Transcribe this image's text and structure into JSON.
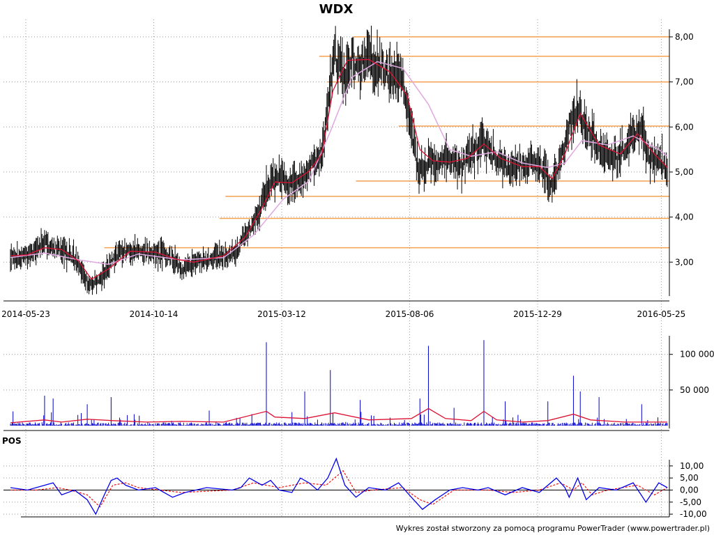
{
  "chart_data": {
    "type": "line",
    "title": "WDX",
    "subtitle": "",
    "xlabel": "",
    "ylabel": "",
    "footer": "Wykres został stworzony za pomocą programu PowerTrader (www.powertrader.pl)",
    "x_tick_labels": [
      "2014-05-23",
      "2014-10-14",
      "2015-03-12",
      "2015-08-06",
      "2015-12-29",
      "2016-05-25"
    ],
    "grid": true,
    "colors": {
      "price": "#000000",
      "ma_short": "#dd1133",
      "ma_long": "#e0a8e0",
      "levels": "#f5a050",
      "volume": "#0000cc",
      "volume_ma": "#dd1133",
      "pos": "#0000ee",
      "pos_signal": "#ee1111"
    },
    "price_panel": {
      "ylim": [
        2.2,
        8.2
      ],
      "y_ticks": [
        3,
        4,
        5,
        6,
        7,
        8
      ],
      "y_tick_labels": [
        "3,00",
        "4,00",
        "5,00",
        "6,00",
        "7,00",
        "8,00"
      ],
      "close_series": [
        [
          0,
          3.12
        ],
        [
          10,
          3.1
        ],
        [
          20,
          3.18
        ],
        [
          30,
          3.25
        ],
        [
          40,
          3.45
        ],
        [
          50,
          3.3
        ],
        [
          60,
          3.25
        ],
        [
          70,
          3.15
        ],
        [
          80,
          3.0
        ],
        [
          88,
          2.6
        ],
        [
          95,
          2.5
        ],
        [
          105,
          2.65
        ],
        [
          115,
          2.9
        ],
        [
          125,
          3.2
        ],
        [
          135,
          3.25
        ],
        [
          150,
          3.25
        ],
        [
          165,
          3.2
        ],
        [
          180,
          3.18
        ],
        [
          190,
          3.1
        ],
        [
          200,
          2.85
        ],
        [
          210,
          2.95
        ],
        [
          220,
          3.0
        ],
        [
          240,
          3.1
        ],
        [
          255,
          3.15
        ],
        [
          265,
          3.2
        ],
        [
          275,
          3.6
        ],
        [
          285,
          3.85
        ],
        [
          295,
          4.3
        ],
        [
          305,
          4.85
        ],
        [
          315,
          4.9
        ],
        [
          325,
          4.75
        ],
        [
          335,
          4.7
        ],
        [
          345,
          4.9
        ],
        [
          355,
          5.2
        ],
        [
          365,
          5.4
        ],
        [
          372,
          6.5
        ],
        [
          380,
          7.6
        ],
        [
          390,
          7.2
        ],
        [
          400,
          7.5
        ],
        [
          410,
          7.3
        ],
        [
          420,
          7.6
        ],
        [
          430,
          7.3
        ],
        [
          445,
          7.2
        ],
        [
          460,
          7.0
        ],
        [
          470,
          6.0
        ],
        [
          478,
          5.0
        ],
        [
          490,
          5.3
        ],
        [
          500,
          5.2
        ],
        [
          510,
          5.3
        ],
        [
          520,
          5.2
        ],
        [
          530,
          5.15
        ],
        [
          545,
          5.5
        ],
        [
          555,
          5.7
        ],
        [
          565,
          5.4
        ],
        [
          575,
          5.2
        ],
        [
          590,
          5.1
        ],
        [
          610,
          5.2
        ],
        [
          625,
          5.1
        ],
        [
          635,
          4.7
        ],
        [
          645,
          5.3
        ],
        [
          655,
          6.0
        ],
        [
          665,
          6.4
        ],
        [
          672,
          6.0
        ],
        [
          680,
          5.8
        ],
        [
          690,
          5.5
        ],
        [
          700,
          5.4
        ],
        [
          710,
          5.3
        ],
        [
          720,
          5.5
        ],
        [
          730,
          5.9
        ],
        [
          740,
          5.9
        ],
        [
          750,
          5.2
        ],
        [
          760,
          5.3
        ],
        [
          770,
          5.05
        ]
      ],
      "ma_short_series": [
        [
          0,
          3.14
        ],
        [
          20,
          3.16
        ],
        [
          40,
          3.32
        ],
        [
          60,
          3.28
        ],
        [
          80,
          3.02
        ],
        [
          95,
          2.62
        ],
        [
          115,
          2.85
        ],
        [
          140,
          3.24
        ],
        [
          170,
          3.22
        ],
        [
          195,
          3.06
        ],
        [
          215,
          3.0
        ],
        [
          250,
          3.14
        ],
        [
          275,
          3.55
        ],
        [
          295,
          4.2
        ],
        [
          310,
          4.78
        ],
        [
          330,
          4.76
        ],
        [
          350,
          5.02
        ],
        [
          365,
          5.4
        ],
        [
          378,
          6.8
        ],
        [
          395,
          7.48
        ],
        [
          420,
          7.5
        ],
        [
          445,
          7.22
        ],
        [
          465,
          6.7
        ],
        [
          480,
          5.5
        ],
        [
          495,
          5.25
        ],
        [
          515,
          5.22
        ],
        [
          535,
          5.3
        ],
        [
          555,
          5.62
        ],
        [
          575,
          5.3
        ],
        [
          600,
          5.12
        ],
        [
          620,
          5.12
        ],
        [
          635,
          4.85
        ],
        [
          650,
          5.4
        ],
        [
          668,
          6.3
        ],
        [
          690,
          5.6
        ],
        [
          715,
          5.4
        ],
        [
          735,
          5.85
        ],
        [
          755,
          5.4
        ],
        [
          770,
          5.1
        ]
      ],
      "ma_long_series": [
        [
          0,
          3.1
        ],
        [
          40,
          3.2
        ],
        [
          80,
          3.05
        ],
        [
          115,
          2.95
        ],
        [
          150,
          3.18
        ],
        [
          200,
          3.05
        ],
        [
          250,
          3.1
        ],
        [
          285,
          3.6
        ],
        [
          320,
          4.4
        ],
        [
          350,
          4.8
        ],
        [
          375,
          5.9
        ],
        [
          400,
          7.1
        ],
        [
          430,
          7.45
        ],
        [
          460,
          7.3
        ],
        [
          490,
          6.5
        ],
        [
          515,
          5.5
        ],
        [
          540,
          5.35
        ],
        [
          570,
          5.45
        ],
        [
          600,
          5.2
        ],
        [
          630,
          5.1
        ],
        [
          650,
          5.2
        ],
        [
          670,
          5.7
        ],
        [
          700,
          5.6
        ],
        [
          730,
          5.8
        ],
        [
          760,
          5.5
        ],
        [
          770,
          5.35
        ]
      ],
      "horizontal_levels": [
        {
          "y": 8.0,
          "x_start": 402
        },
        {
          "y": 7.57,
          "x_start": 362
        },
        {
          "y": 7.0,
          "x_start": 372
        },
        {
          "y": 6.02,
          "x_start": 455
        },
        {
          "y": 4.8,
          "x_start": 405
        },
        {
          "y": 4.46,
          "x_start": 252
        },
        {
          "y": 3.97,
          "x_start": 245
        },
        {
          "y": 3.32,
          "x_start": 110
        }
      ]
    },
    "volume_panel": {
      "ylim": [
        0,
        130000
      ],
      "y_ticks": [
        50000,
        100000
      ],
      "y_tick_labels": [
        "50 000",
        "100 000"
      ],
      "spikes": [
        [
          40,
          42000
        ],
        [
          50,
          38000
        ],
        [
          90,
          30000
        ],
        [
          118,
          40000
        ],
        [
          300,
          117000
        ],
        [
          345,
          48000
        ],
        [
          375,
          78000
        ],
        [
          410,
          36000
        ],
        [
          480,
          38000
        ],
        [
          490,
          112000
        ],
        [
          520,
          25000
        ],
        [
          580,
          34000
        ],
        [
          555,
          120000
        ],
        [
          630,
          34000
        ],
        [
          660,
          70000
        ],
        [
          668,
          48000
        ],
        [
          690,
          40000
        ],
        [
          740,
          30000
        ]
      ],
      "ma_series": [
        [
          0,
          4000
        ],
        [
          40,
          8000
        ],
        [
          60,
          5000
        ],
        [
          90,
          9000
        ],
        [
          120,
          7000
        ],
        [
          160,
          5000
        ],
        [
          200,
          6000
        ],
        [
          250,
          5000
        ],
        [
          300,
          20000
        ],
        [
          310,
          12000
        ],
        [
          345,
          10000
        ],
        [
          380,
          18000
        ],
        [
          420,
          8000
        ],
        [
          470,
          10000
        ],
        [
          490,
          24000
        ],
        [
          510,
          10000
        ],
        [
          540,
          7000
        ],
        [
          555,
          20000
        ],
        [
          570,
          8000
        ],
        [
          600,
          5000
        ],
        [
          630,
          7000
        ],
        [
          660,
          16000
        ],
        [
          680,
          8000
        ],
        [
          720,
          5000
        ],
        [
          770,
          5000
        ]
      ]
    },
    "pos_panel": {
      "label": "POS",
      "ylim": [
        -12,
        14
      ],
      "y_ticks": [
        10,
        5,
        0,
        -5,
        -10
      ],
      "y_tick_labels": [
        "10,00",
        "5,00",
        "0,00",
        "-5,00",
        "-10,00"
      ],
      "pos_series": [
        [
          0,
          1
        ],
        [
          20,
          0
        ],
        [
          50,
          3
        ],
        [
          60,
          -2
        ],
        [
          75,
          0
        ],
        [
          90,
          -4
        ],
        [
          100,
          -10
        ],
        [
          110,
          -2
        ],
        [
          118,
          4
        ],
        [
          125,
          5
        ],
        [
          135,
          2
        ],
        [
          150,
          0
        ],
        [
          170,
          1
        ],
        [
          190,
          -3
        ],
        [
          205,
          -1
        ],
        [
          230,
          1
        ],
        [
          260,
          0
        ],
        [
          270,
          1
        ],
        [
          280,
          5
        ],
        [
          295,
          2
        ],
        [
          305,
          4
        ],
        [
          315,
          0
        ],
        [
          330,
          -1
        ],
        [
          340,
          5
        ],
        [
          350,
          3
        ],
        [
          360,
          0
        ],
        [
          372,
          5
        ],
        [
          382,
          13
        ],
        [
          392,
          2
        ],
        [
          405,
          -3
        ],
        [
          420,
          1
        ],
        [
          440,
          0
        ],
        [
          455,
          3
        ],
        [
          470,
          -3
        ],
        [
          483,
          -8
        ],
        [
          498,
          -4
        ],
        [
          515,
          0
        ],
        [
          530,
          1
        ],
        [
          548,
          0
        ],
        [
          560,
          1
        ],
        [
          580,
          -2
        ],
        [
          600,
          1
        ],
        [
          620,
          -1
        ],
        [
          640,
          5
        ],
        [
          650,
          1
        ],
        [
          655,
          -3
        ],
        [
          665,
          5
        ],
        [
          675,
          -4
        ],
        [
          690,
          1
        ],
        [
          710,
          0
        ],
        [
          730,
          3
        ],
        [
          745,
          -5
        ],
        [
          760,
          3
        ],
        [
          770,
          1
        ]
      ],
      "signal_series": [
        [
          0,
          0
        ],
        [
          30,
          0
        ],
        [
          55,
          1
        ],
        [
          70,
          0
        ],
        [
          90,
          -2
        ],
        [
          105,
          -7
        ],
        [
          120,
          2
        ],
        [
          135,
          3
        ],
        [
          150,
          1
        ],
        [
          200,
          -1
        ],
        [
          260,
          0
        ],
        [
          285,
          3
        ],
        [
          315,
          1
        ],
        [
          345,
          3
        ],
        [
          370,
          2
        ],
        [
          390,
          8
        ],
        [
          405,
          -1
        ],
        [
          425,
          0
        ],
        [
          460,
          1
        ],
        [
          480,
          -4
        ],
        [
          495,
          -6
        ],
        [
          520,
          0
        ],
        [
          560,
          0
        ],
        [
          590,
          -1
        ],
        [
          620,
          0
        ],
        [
          645,
          3
        ],
        [
          660,
          0
        ],
        [
          670,
          3
        ],
        [
          682,
          -2
        ],
        [
          700,
          0
        ],
        [
          735,
          2
        ],
        [
          755,
          -2
        ],
        [
          770,
          1
        ]
      ]
    }
  }
}
